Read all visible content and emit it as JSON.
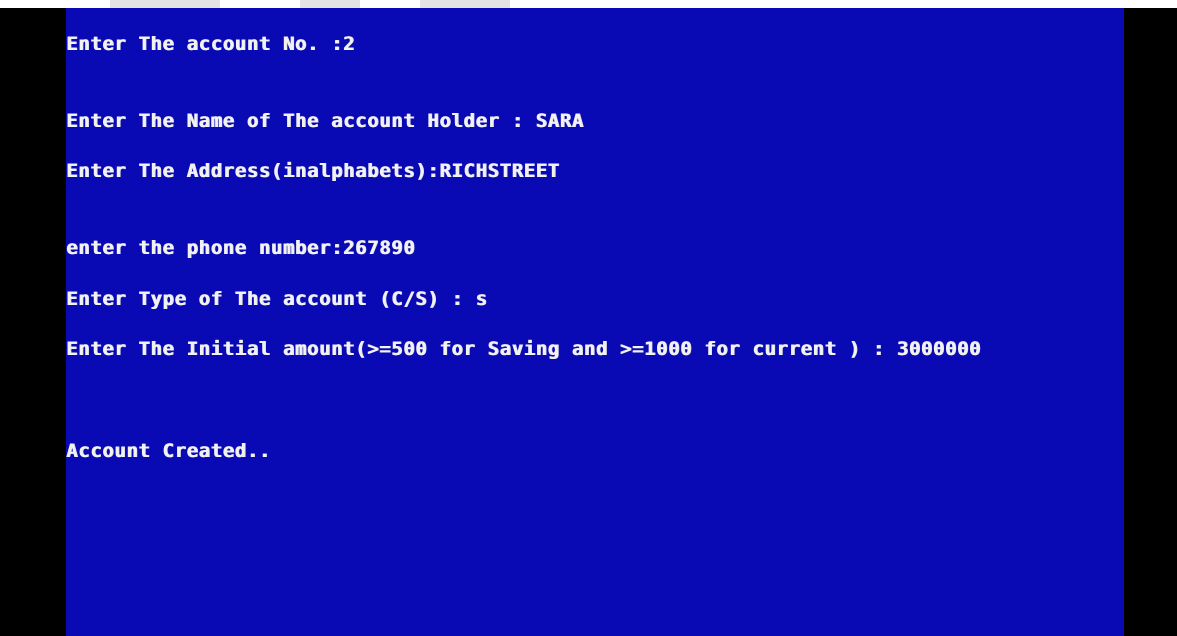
{
  "console": {
    "background_color": "#0a0ab4",
    "text_color": "#f2f2f2",
    "border_color": "#000000",
    "lines": {
      "account_no": "Enter The account No. :2",
      "holder_name": "Enter The Name of The account Holder : SARA",
      "address": "Enter The Address(inalphabets):RICHSTREET",
      "phone": "enter the phone number:267890",
      "account_type": "Enter Type of The account (C/S) : s",
      "initial_amount": "Enter The Initial amount(>=500 for Saving and >=1000 for current ) : 3000000",
      "status": "Account Created.."
    }
  }
}
